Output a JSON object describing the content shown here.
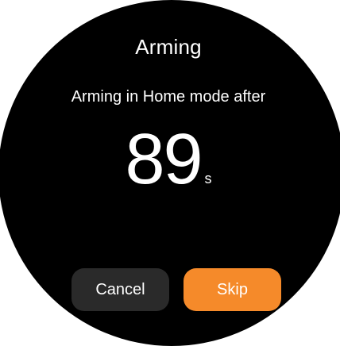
{
  "screen": {
    "title": "Arming",
    "subtitle": "Arming in Home mode after",
    "countdown_value": "89",
    "countdown_unit": "s"
  },
  "actions": {
    "cancel_label": "Cancel",
    "skip_label": "Skip"
  },
  "colors": {
    "background": "#000000",
    "text": "#ffffff",
    "cancel_button": "#2a2a2a",
    "skip_button": "#f58a2a"
  }
}
